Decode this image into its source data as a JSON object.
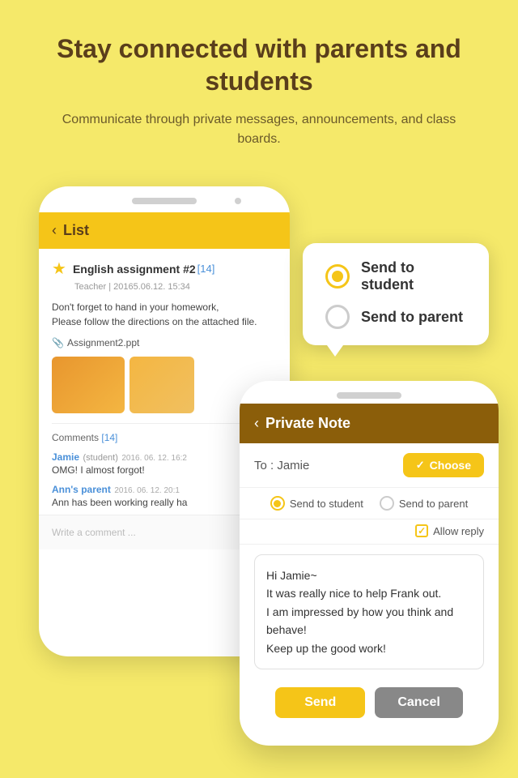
{
  "header": {
    "title": "Stay connected with parents and students",
    "subtitle": "Communicate through private messages, announcements, and class boards."
  },
  "phone_back": {
    "topbar": {
      "back_label": "‹",
      "title": "List"
    },
    "post": {
      "star": "★",
      "title": "English assignment #2",
      "badge": "[14]",
      "meta": "Teacher  |  20165.06.12.  15:34",
      "body_line1": "Don't forget to hand in your homework,",
      "body_line2": "Please follow the directions on the attached file.",
      "attachment": "Assignment2.ppt"
    },
    "comments": {
      "label": "Comments",
      "badge": "[14]",
      "comment1": {
        "name": "Jamie",
        "role": "(student)",
        "time": "2016. 06. 12. 16:2",
        "text": "OMG! I almost forgot!"
      },
      "comment2": {
        "name": "Ann's parent",
        "time": "2016. 06. 12. 20:1",
        "text": "Ann has been working really ha"
      }
    },
    "write_placeholder": "Write a comment ..."
  },
  "tooltip": {
    "option1_label": "Send to student",
    "option2_label": "Send to parent"
  },
  "phone_front": {
    "topbar": {
      "back_label": "‹",
      "title": "Private Note"
    },
    "to_label": "To : Jamie",
    "choose_label": "Choose",
    "radio_student": "Send to student",
    "radio_parent": "Send to parent",
    "allow_reply": "Allow reply",
    "message": "Hi Jamie~\nIt was really nice to help Frank out.\nI am impressed by how you think and behave!\nKeep up the good work!",
    "send_label": "Send",
    "cancel_label": "Cancel"
  }
}
